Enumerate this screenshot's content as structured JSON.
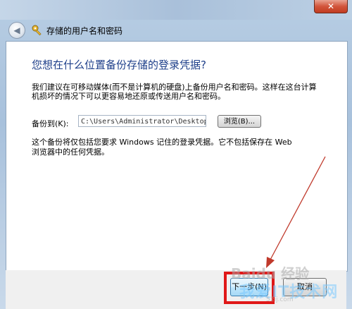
{
  "window": {
    "title": "存储的用户名和密码",
    "close_label": "✕"
  },
  "content": {
    "heading": "您想在什么位置备份存储的登录凭据?",
    "description": "我们建议在可移动媒体(而不是计算机的硬盘)上备份用户名和密码。这样在这台计算机损坏的情况下可以更容易地还原或传送用户名和密码。",
    "backup_label": "备份到(K):",
    "backup_path": "C:\\Users\\Administrator\\Desktop\\S",
    "browse_label": "浏览(B)...",
    "note": "这个备份将仅包括您要求 Windows 记住的登录凭据。它不包括保存在 Web 浏览器中的任何凭据。"
  },
  "footer": {
    "next_label": "下一步(N)",
    "cancel_label": "取消"
  },
  "watermark": {
    "line1": "Baidu 经验",
    "line2": "我爱IT技术网",
    "line3": "52ij.com"
  },
  "colors": {
    "heading": "#1e3f8a",
    "highlight": "#e01818",
    "arrow": "#c0392b"
  },
  "icons": {
    "back": "back-arrow-icon",
    "key": "key-icon",
    "close": "close-icon"
  }
}
